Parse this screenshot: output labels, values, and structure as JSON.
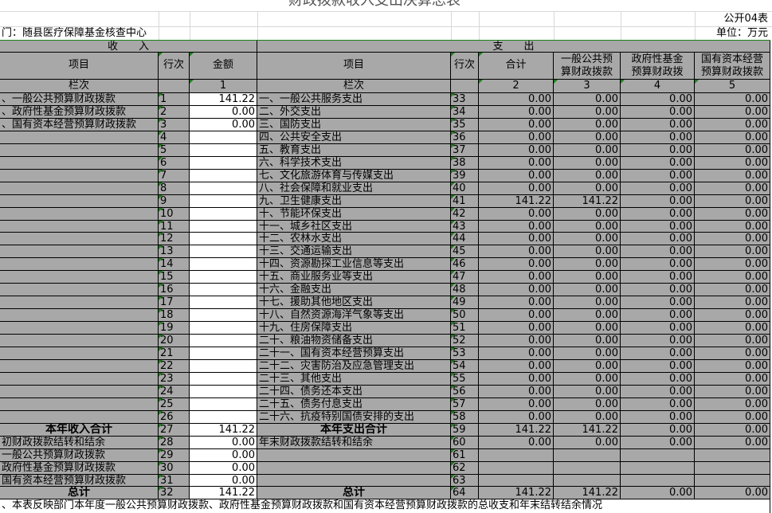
{
  "title": "财政拨款收入支出决算总表",
  "form_code": "公开04表",
  "department": "门：随县医疗保障基金核查中心",
  "unit": "单位：万元",
  "income_header": "收　　入",
  "expense_header": "支　　出",
  "col_item": "项目",
  "col_row": "行次",
  "col_amount": "金额",
  "col_total": "合计",
  "col_general": [
    "一般公共预",
    "算财政拨款"
  ],
  "col_fund": [
    "政府性基金",
    "预算财政拨"
  ],
  "col_soe": [
    "国有资本经营",
    "预算财政拨款"
  ],
  "lanci": "栏次",
  "col_nums": [
    "1",
    "2",
    "3",
    "4",
    "5"
  ],
  "income_rows": [
    {
      "label": "、一般公共预算财政拨款",
      "row": "1",
      "amount": "141.22"
    },
    {
      "label": "、政府性基金预算财政拨款",
      "row": "2",
      "amount": "0.00"
    },
    {
      "label": "、国有资本经营预算财政拨款",
      "row": "3",
      "amount": "0.00"
    },
    {
      "label": "",
      "row": "4",
      "amount": ""
    },
    {
      "label": "",
      "row": "5",
      "amount": ""
    },
    {
      "label": "",
      "row": "6",
      "amount": ""
    },
    {
      "label": "",
      "row": "7",
      "amount": ""
    },
    {
      "label": "",
      "row": "8",
      "amount": ""
    },
    {
      "label": "",
      "row": "9",
      "amount": ""
    },
    {
      "label": "",
      "row": "10",
      "amount": ""
    },
    {
      "label": "",
      "row": "11",
      "amount": ""
    },
    {
      "label": "",
      "row": "12",
      "amount": ""
    },
    {
      "label": "",
      "row": "13",
      "amount": ""
    },
    {
      "label": "",
      "row": "14",
      "amount": ""
    },
    {
      "label": "",
      "row": "15",
      "amount": ""
    },
    {
      "label": "",
      "row": "16",
      "amount": ""
    },
    {
      "label": "",
      "row": "17",
      "amount": ""
    },
    {
      "label": "",
      "row": "18",
      "amount": ""
    },
    {
      "label": "",
      "row": "19",
      "amount": ""
    },
    {
      "label": "",
      "row": "20",
      "amount": ""
    },
    {
      "label": "",
      "row": "21",
      "amount": ""
    },
    {
      "label": "",
      "row": "22",
      "amount": ""
    },
    {
      "label": "",
      "row": "23",
      "amount": ""
    },
    {
      "label": "",
      "row": "24",
      "amount": ""
    },
    {
      "label": "",
      "row": "25",
      "amount": ""
    },
    {
      "label": "",
      "row": "26",
      "amount": ""
    },
    {
      "label": "本年收入合计",
      "row": "27",
      "amount": "141.22"
    },
    {
      "label": "初财政拨款结转和结余",
      "row": "28",
      "amount": "0.00"
    },
    {
      "label": "一般公共预算财政拨款",
      "row": "29",
      "amount": "0.00"
    },
    {
      "label": "政府性基金预算财政拨款",
      "row": "30",
      "amount": "0.00"
    },
    {
      "label": "国有资本经营预算财政拨款",
      "row": "31",
      "amount": "0.00"
    },
    {
      "label": "总计",
      "row": "32",
      "amount": "141.22"
    }
  ],
  "expense_rows": [
    {
      "label": "一、一般公共服务支出",
      "row": "33",
      "v": [
        "0.00",
        "0.00",
        "0.00",
        "0.00"
      ]
    },
    {
      "label": "二、外交支出",
      "row": "34",
      "v": [
        "0.00",
        "0.00",
        "0.00",
        "0.00"
      ]
    },
    {
      "label": "三、国防支出",
      "row": "35",
      "v": [
        "0.00",
        "0.00",
        "0.00",
        "0.00"
      ]
    },
    {
      "label": "四、公共安全支出",
      "row": "36",
      "v": [
        "0.00",
        "0.00",
        "0.00",
        "0.00"
      ]
    },
    {
      "label": "五、教育支出",
      "row": "37",
      "v": [
        "0.00",
        "0.00",
        "0.00",
        "0.00"
      ]
    },
    {
      "label": "六、科学技术支出",
      "row": "38",
      "v": [
        "0.00",
        "0.00",
        "0.00",
        "0.00"
      ]
    },
    {
      "label": "七、文化旅游体育与传媒支出",
      "row": "39",
      "v": [
        "0.00",
        "0.00",
        "0.00",
        "0.00"
      ]
    },
    {
      "label": "八、社会保障和就业支出",
      "row": "40",
      "v": [
        "0.00",
        "0.00",
        "0.00",
        "0.00"
      ]
    },
    {
      "label": "九、卫生健康支出",
      "row": "41",
      "v": [
        "141.22",
        "141.22",
        "0.00",
        "0.00"
      ]
    },
    {
      "label": "十、节能环保支出",
      "row": "42",
      "v": [
        "0.00",
        "0.00",
        "0.00",
        "0.00"
      ]
    },
    {
      "label": "十一、城乡社区支出",
      "row": "43",
      "v": [
        "0.00",
        "0.00",
        "0.00",
        "0.00"
      ]
    },
    {
      "label": "十二、农林水支出",
      "row": "44",
      "v": [
        "0.00",
        "0.00",
        "0.00",
        "0.00"
      ]
    },
    {
      "label": "十三、交通运输支出",
      "row": "45",
      "v": [
        "0.00",
        "0.00",
        "0.00",
        "0.00"
      ]
    },
    {
      "label": "十四、资源勘探工业信息等支出",
      "row": "46",
      "v": [
        "0.00",
        "0.00",
        "0.00",
        "0.00"
      ]
    },
    {
      "label": "十五、商业服务业等支出",
      "row": "47",
      "v": [
        "0.00",
        "0.00",
        "0.00",
        "0.00"
      ]
    },
    {
      "label": "十六、金融支出",
      "row": "48",
      "v": [
        "0.00",
        "0.00",
        "0.00",
        "0.00"
      ]
    },
    {
      "label": "十七、援助其他地区支出",
      "row": "49",
      "v": [
        "0.00",
        "0.00",
        "0.00",
        "0.00"
      ]
    },
    {
      "label": "十八、自然资源海洋气象等支出",
      "row": "50",
      "v": [
        "0.00",
        "0.00",
        "0.00",
        "0.00"
      ]
    },
    {
      "label": "十九、住房保障支出",
      "row": "51",
      "v": [
        "0.00",
        "0.00",
        "0.00",
        "0.00"
      ]
    },
    {
      "label": "二十、粮油物资储备支出",
      "row": "52",
      "v": [
        "0.00",
        "0.00",
        "0.00",
        "0.00"
      ]
    },
    {
      "label": "二十一、国有资本经营预算支出",
      "row": "53",
      "v": [
        "0.00",
        "0.00",
        "0.00",
        "0.00"
      ]
    },
    {
      "label": "二十二、灾害防治及应急管理支出",
      "row": "54",
      "v": [
        "0.00",
        "0.00",
        "0.00",
        "0.00"
      ]
    },
    {
      "label": "二十三、其他支出",
      "row": "55",
      "v": [
        "0.00",
        "0.00",
        "0.00",
        "0.00"
      ]
    },
    {
      "label": "二十四、债务还本支出",
      "row": "56",
      "v": [
        "0.00",
        "0.00",
        "0.00",
        "0.00"
      ]
    },
    {
      "label": "二十五、债务付息支出",
      "row": "57",
      "v": [
        "0.00",
        "0.00",
        "0.00",
        "0.00"
      ]
    },
    {
      "label": "二十六、抗疫特别国债安排的支出",
      "row": "58",
      "v": [
        "0.00",
        "0.00",
        "0.00",
        "0.00"
      ]
    },
    {
      "label": "本年支出合计",
      "row": "59",
      "v": [
        "141.22",
        "141.22",
        "0.00",
        "0.00"
      ]
    },
    {
      "label": "年末财政拨款结转和结余",
      "row": "60",
      "v": [
        "0.00",
        "0.00",
        "0.00",
        "0.00"
      ]
    },
    {
      "label": "",
      "row": "61",
      "v": [
        "",
        "",
        "",
        ""
      ]
    },
    {
      "label": "",
      "row": "62",
      "v": [
        "",
        "",
        "",
        ""
      ]
    },
    {
      "label": "",
      "row": "63",
      "v": [
        "",
        "",
        "",
        ""
      ]
    },
    {
      "label": "总计",
      "row": "64",
      "v": [
        "141.22",
        "141.22",
        "0.00",
        "0.00"
      ]
    }
  ],
  "footnote": "、本表反映部门本年度一般公共预算财政拨款、政府性基金预算财政拨款和国有资本经营预算财政拨款的总收支和年末结转结余情况"
}
